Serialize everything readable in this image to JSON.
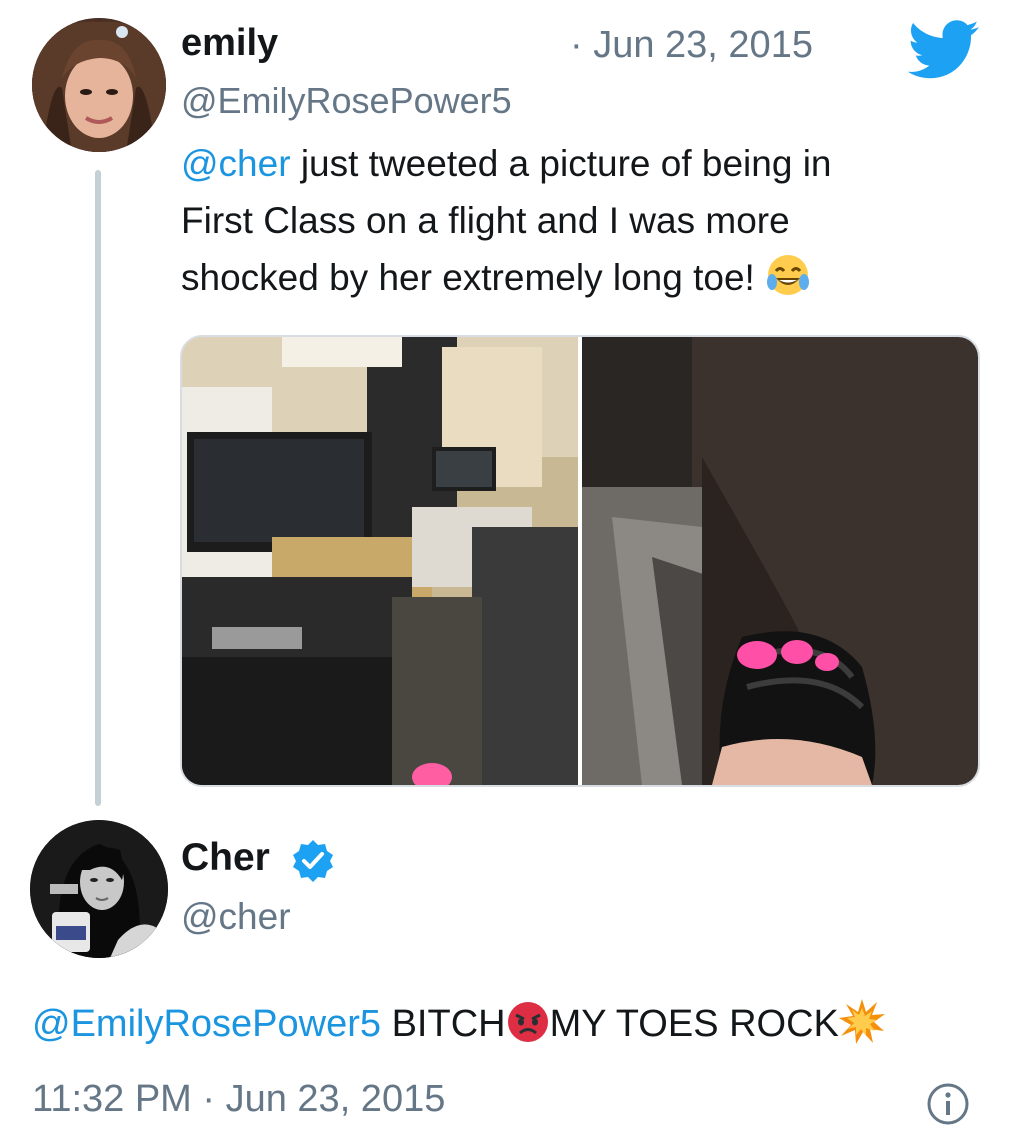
{
  "tweet_original": {
    "author_name": "emily",
    "separator_date": "· Jun 23, 2015",
    "handle": "@EmilyRosePower5",
    "mention": "@cher",
    "text_line_1": " just tweeted a picture of being in",
    "text_line_2": "First Class on a flight and I was more",
    "text_line_3": "shocked by her extremely long toe! ",
    "emoji": "laughing-tears-icon",
    "media_count": 2
  },
  "tweet_reply": {
    "author_name": "Cher",
    "verified": true,
    "handle": "@cher",
    "mention": "@EmilyRosePower5",
    "text_part_1": " BITCH",
    "text_part_2": "MY TOES ROCK",
    "emojis": [
      "angry-face-icon",
      "collision-icon"
    ],
    "timestamp": "11:32 PM · Jun 23, 2015"
  },
  "colors": {
    "link_blue": "#1b95e0",
    "twitter_blue": "#1da1f2",
    "secondary_gray": "#657786",
    "thread_line": "#c4cfd6"
  }
}
